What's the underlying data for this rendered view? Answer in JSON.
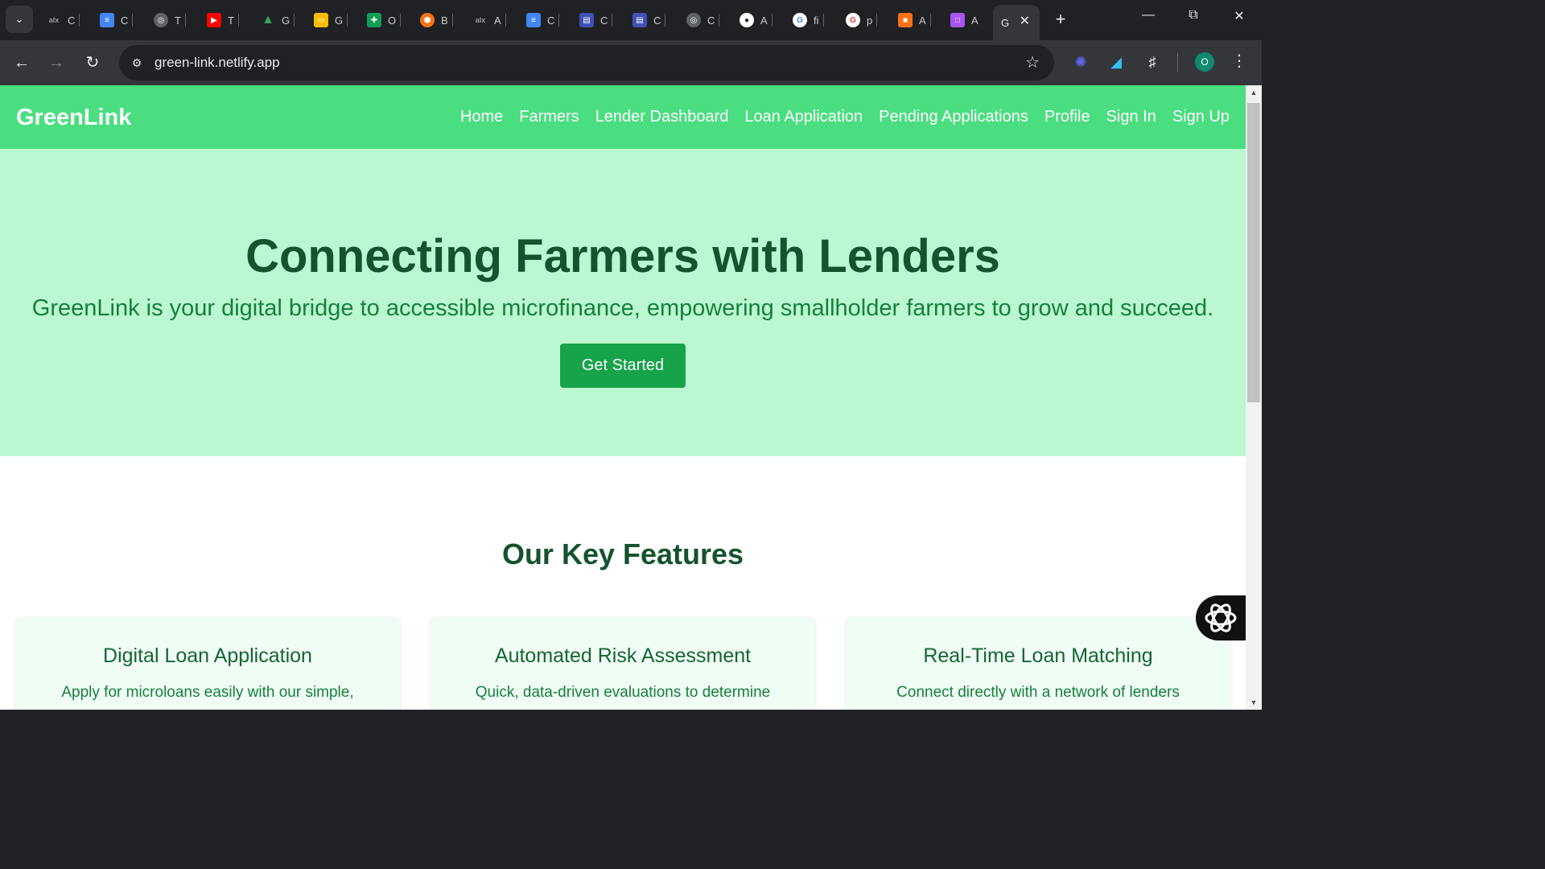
{
  "browser": {
    "tabs": [
      {
        "initial": "C",
        "icon": "alx-icon",
        "color": "#202124"
      },
      {
        "initial": "C",
        "icon": "google-docs-icon",
        "color": "#4285f4"
      },
      {
        "initial": "T",
        "icon": "globe-icon",
        "color": "#9aa0a6"
      },
      {
        "initial": "T",
        "icon": "youtube-icon",
        "color": "#ff0000"
      },
      {
        "initial": "G",
        "icon": "google-drive-icon",
        "color": "#34a853"
      },
      {
        "initial": "G",
        "icon": "google-slides-icon",
        "color": "#fbbc04"
      },
      {
        "initial": "O",
        "icon": "google-sheets-icon",
        "color": "#0f9d58"
      },
      {
        "initial": "B",
        "icon": "orange-hexagon-icon",
        "color": "#f97316"
      },
      {
        "initial": "A",
        "icon": "alx-icon",
        "color": "#202124"
      },
      {
        "initial": "C",
        "icon": "google-docs-icon",
        "color": "#4285f4"
      },
      {
        "initial": "C",
        "icon": "forms-icon",
        "color": "#3f51b5"
      },
      {
        "initial": "C",
        "icon": "forms-icon",
        "color": "#3f51b5"
      },
      {
        "initial": "C",
        "icon": "globe-icon",
        "color": "#9aa0a6"
      },
      {
        "initial": "A",
        "icon": "github-icon",
        "color": "#ffffff"
      },
      {
        "initial": "fi",
        "icon": "google-icon",
        "color": "#ffffff"
      },
      {
        "initial": "p",
        "icon": "google-lens-icon",
        "color": "#ffffff"
      },
      {
        "initial": "A",
        "icon": "orange-cube-icon",
        "color": "#f97316"
      },
      {
        "initial": "A",
        "icon": "purple-cube-icon",
        "color": "#a855f7"
      }
    ],
    "active_tab_initial": "G",
    "url": "green-link.netlify.app",
    "profile_initial": "O"
  },
  "site": {
    "brand": "GreenLink",
    "nav": [
      "Home",
      "Farmers",
      "Lender Dashboard",
      "Loan Application",
      "Pending Applications",
      "Profile",
      "Sign In",
      "Sign Up"
    ],
    "hero": {
      "title": "Connecting Farmers with Lenders",
      "subtitle": "GreenLink is your digital bridge to accessible microfinance, empowering smallholder farmers to grow and succeed.",
      "cta": "Get Started"
    },
    "features": {
      "title": "Our Key Features",
      "cards": [
        {
          "title": "Digital Loan Application",
          "text": "Apply for microloans easily with our simple,"
        },
        {
          "title": "Automated Risk Assessment",
          "text": "Quick, data-driven evaluations to determine"
        },
        {
          "title": "Real-Time Loan Matching",
          "text": "Connect directly with a network of lenders"
        }
      ]
    }
  },
  "colors": {
    "nav_bg": "#4ade80",
    "hero_bg": "#bbf7d0",
    "cta_bg": "#16a34a",
    "heading": "#14532d",
    "card_bg": "#f0fdf4"
  }
}
